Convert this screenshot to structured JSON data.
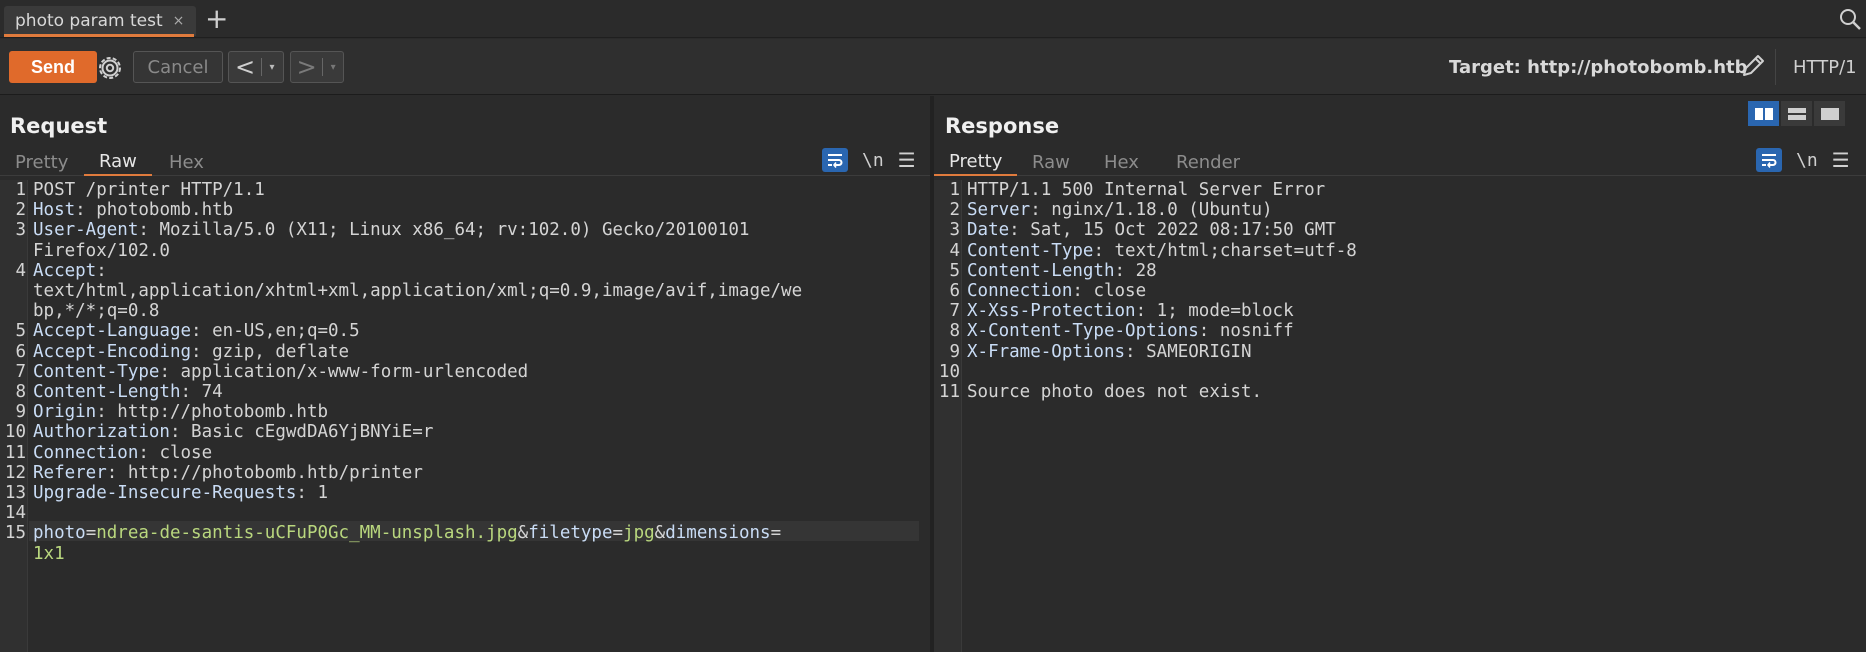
{
  "tab": {
    "title": "photo param test",
    "close": "×",
    "add": "+"
  },
  "toolbar": {
    "send": "Send",
    "cancel": "Cancel",
    "prev": "<",
    "next": ">",
    "dropdown": "▾",
    "target_label": "Target:",
    "target_url": "http://photobomb.htb",
    "http_version": "HTTP/1"
  },
  "request": {
    "title": "Request",
    "tabs": [
      "Pretty",
      "Raw",
      "Hex"
    ],
    "active_tab": "Raw",
    "newline_toggle": "\\n",
    "menu": "☰",
    "lines": [
      {
        "n": "1",
        "text": "POST /printer HTTP/1.1"
      },
      {
        "n": "2",
        "name": "Host",
        "value": " photobomb.htb"
      },
      {
        "n": "3",
        "name": "User-Agent",
        "value": " Mozilla/5.0 (X11; Linux x86_64; rv:102.0) Gecko/20100101"
      },
      {
        "n": "",
        "text": "Firefox/102.0"
      },
      {
        "n": "4",
        "name": "Accept",
        "value": ""
      },
      {
        "n": "",
        "text": "text/html,application/xhtml+xml,application/xml;q=0.9,image/avif,image/we"
      },
      {
        "n": "",
        "text": "bp,*/*;q=0.8"
      },
      {
        "n": "5",
        "name": "Accept-Language",
        "value": " en-US,en;q=0.5"
      },
      {
        "n": "6",
        "name": "Accept-Encoding",
        "value": " gzip, deflate"
      },
      {
        "n": "7",
        "name": "Content-Type",
        "value": " application/x-www-form-urlencoded"
      },
      {
        "n": "8",
        "name": "Content-Length",
        "value": " 74"
      },
      {
        "n": "9",
        "name": "Origin",
        "value": " http://photobomb.htb"
      },
      {
        "n": "10",
        "name": "Authorization",
        "value": " Basic cEgwdDA6YjBNYiE=r"
      },
      {
        "n": "11",
        "name": "Connection",
        "value": " close"
      },
      {
        "n": "12",
        "name": "Referer",
        "value": " http://photobomb.htb/printer"
      },
      {
        "n": "13",
        "name": "Upgrade-Insecure-Requests",
        "value": " 1"
      },
      {
        "n": "14",
        "text": ""
      }
    ],
    "body": {
      "n": "15",
      "params": [
        {
          "key": "photo",
          "value": "ndrea-de-santis-uCFuP0Gc_MM-unsplash.jpg"
        },
        {
          "key": "filetype",
          "value": "jpg"
        },
        {
          "key": "dimensions",
          "value": ""
        }
      ],
      "wrap": "1x1"
    }
  },
  "response": {
    "title": "Response",
    "tabs": [
      "Pretty",
      "Raw",
      "Hex",
      "Render"
    ],
    "active_tab": "Pretty",
    "newline_toggle": "\\n",
    "menu": "☰",
    "lines": [
      {
        "n": "1",
        "text": "HTTP/1.1 500 Internal Server Error"
      },
      {
        "n": "2",
        "name": "Server",
        "value": " nginx/1.18.0 (Ubuntu)"
      },
      {
        "n": "3",
        "name": "Date",
        "value": " Sat, 15 Oct 2022 08:17:50 GMT"
      },
      {
        "n": "4",
        "name": "Content-Type",
        "value": " text/html;charset=utf-8"
      },
      {
        "n": "5",
        "name": "Content-Length",
        "value": " 28"
      },
      {
        "n": "6",
        "name": "Connection",
        "value": " close"
      },
      {
        "n": "7",
        "name": "X-Xss-Protection",
        "value": " 1; mode=block"
      },
      {
        "n": "8",
        "name": "X-Content-Type-Options",
        "value": " nosniff"
      },
      {
        "n": "9",
        "name": "X-Frame-Options",
        "value": " SAMEORIGIN"
      },
      {
        "n": "10",
        "text": ""
      },
      {
        "n": "11",
        "text": "Source photo does not exist."
      }
    ]
  },
  "colors": {
    "accent": "#e06a2b",
    "toggle_blue": "#2a66b0",
    "param_value": "#b9d77e"
  }
}
